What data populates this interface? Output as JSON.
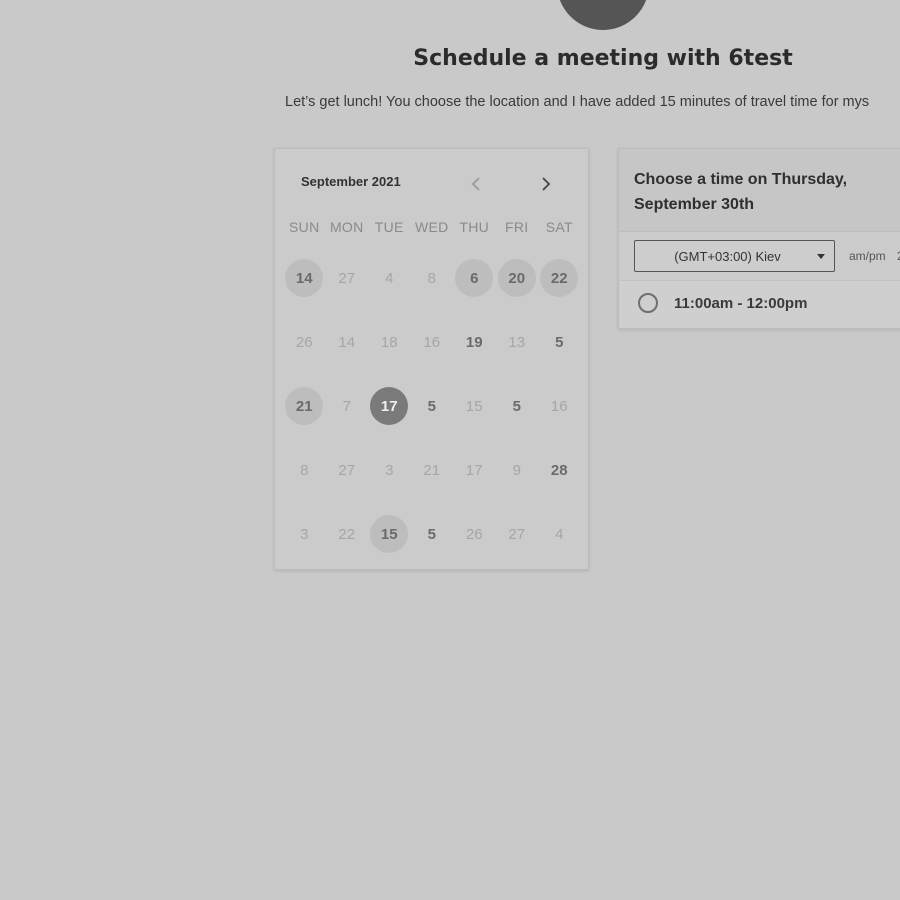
{
  "header": {
    "title": "Schedule a meeting with 6test",
    "subtitle": "Let’s get lunch! You choose the location and I have added 15 minutes of travel time for mys"
  },
  "calendar": {
    "month_label": "September 2021",
    "prev_icon": "chevron-left-icon",
    "next_icon": "chevron-right-icon",
    "weekdays": [
      "SUN",
      "MON",
      "TUE",
      "WED",
      "THU",
      "FRI",
      "SAT"
    ],
    "weeks": [
      [
        {
          "label": "14",
          "state": "available"
        },
        {
          "label": "27",
          "state": "disabled"
        },
        {
          "label": "4",
          "state": "disabled"
        },
        {
          "label": "8",
          "state": "disabled"
        },
        {
          "label": "6",
          "state": "available"
        },
        {
          "label": "20",
          "state": "available"
        },
        {
          "label": "22",
          "state": "available"
        }
      ],
      [
        {
          "label": "26",
          "state": "disabled"
        },
        {
          "label": "14",
          "state": "disabled"
        },
        {
          "label": "18",
          "state": "disabled"
        },
        {
          "label": "16",
          "state": "disabled"
        },
        {
          "label": "19",
          "state": "enabled"
        },
        {
          "label": "13",
          "state": "disabled"
        },
        {
          "label": "5",
          "state": "enabled"
        }
      ],
      [
        {
          "label": "21",
          "state": "available"
        },
        {
          "label": "7",
          "state": "disabled"
        },
        {
          "label": "17",
          "state": "selected"
        },
        {
          "label": "5",
          "state": "enabled"
        },
        {
          "label": "15",
          "state": "disabled"
        },
        {
          "label": "5",
          "state": "enabled"
        },
        {
          "label": "16",
          "state": "disabled"
        }
      ],
      [
        {
          "label": "8",
          "state": "disabled"
        },
        {
          "label": "27",
          "state": "disabled"
        },
        {
          "label": "3",
          "state": "disabled"
        },
        {
          "label": "21",
          "state": "disabled"
        },
        {
          "label": "17",
          "state": "disabled"
        },
        {
          "label": "9",
          "state": "disabled"
        },
        {
          "label": "28",
          "state": "enabled"
        }
      ],
      [
        {
          "label": "3",
          "state": "disabled"
        },
        {
          "label": "22",
          "state": "disabled"
        },
        {
          "label": "15",
          "state": "available"
        },
        {
          "label": "5",
          "state": "enabled"
        },
        {
          "label": "26",
          "state": "disabled"
        },
        {
          "label": "27",
          "state": "disabled"
        },
        {
          "label": "4",
          "state": "disabled"
        }
      ]
    ]
  },
  "time_panel": {
    "heading": "Choose a time on Thursday, September 30th",
    "timezone_value": "(GMT+03:00) Kiev",
    "caret_icon": "caret-down-icon",
    "ampm_label": "am/pm",
    "ampm_alt": "2",
    "slots": [
      {
        "label": "11:00am - 12:00pm"
      }
    ]
  },
  "colors": {
    "background": "#c9c9c9",
    "selected_day": "#7a7a7a",
    "available_day": "#bdbdbd"
  }
}
